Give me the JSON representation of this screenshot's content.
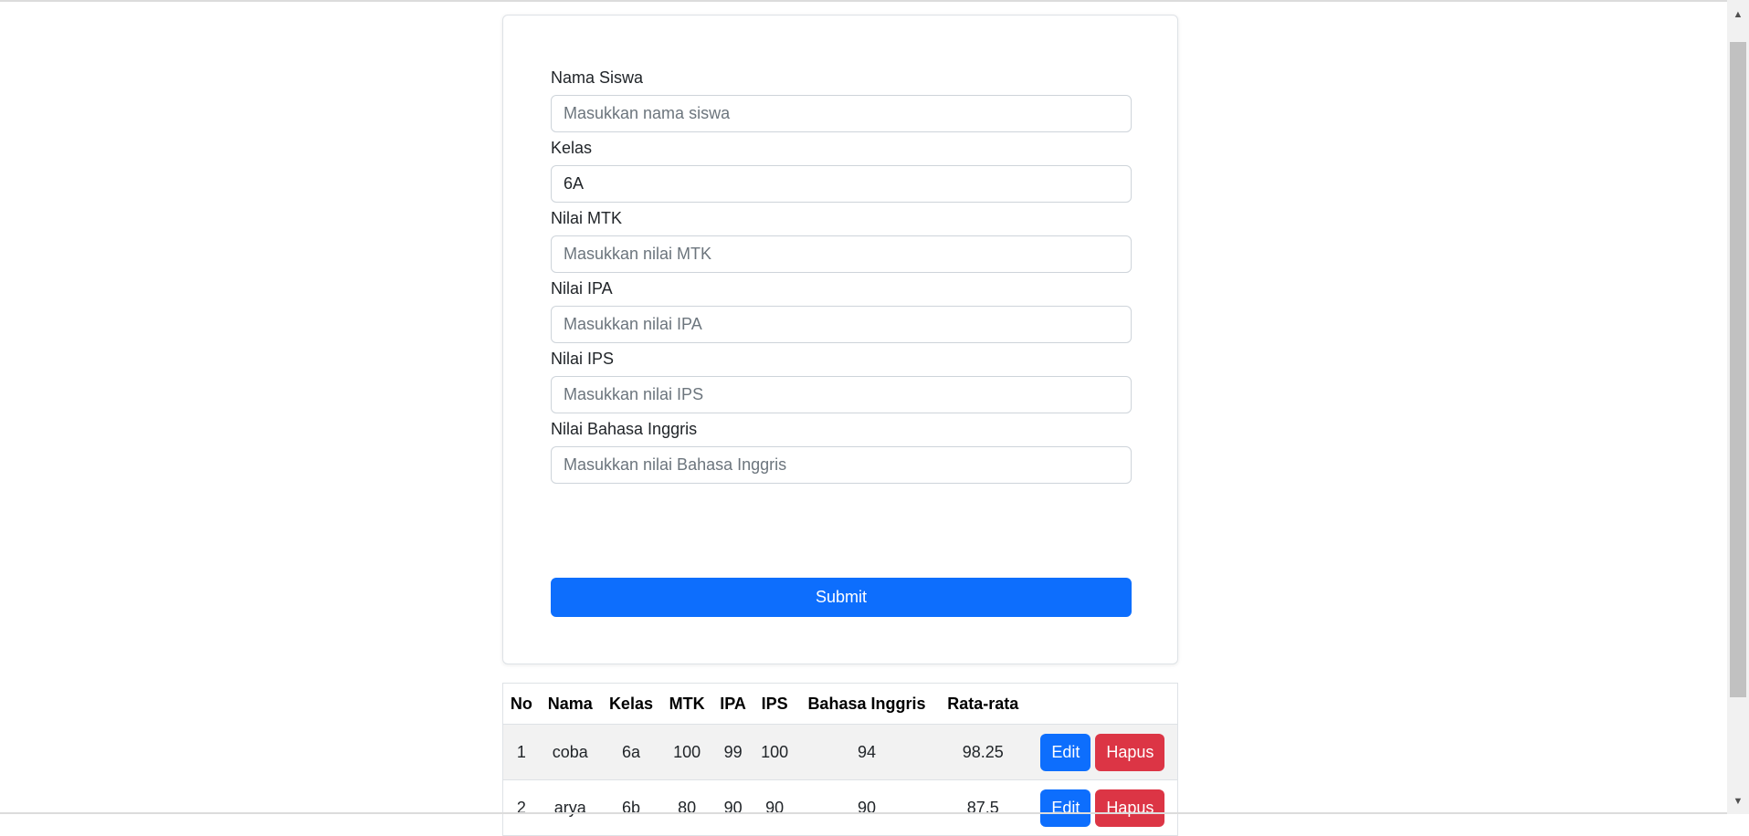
{
  "form": {
    "fields": [
      {
        "label": "Nama Siswa",
        "placeholder": "Masukkan nama siswa",
        "value": ""
      },
      {
        "label": "Kelas",
        "placeholder": "",
        "value": "6A"
      },
      {
        "label": "Nilai MTK",
        "placeholder": "Masukkan nilai MTK",
        "value": ""
      },
      {
        "label": "Nilai IPA",
        "placeholder": "Masukkan nilai IPA",
        "value": ""
      },
      {
        "label": "Nilai IPS",
        "placeholder": "Masukkan nilai IPS",
        "value": ""
      },
      {
        "label": "Nilai Bahasa Inggris",
        "placeholder": "Masukkan nilai Bahasa Inggris",
        "value": ""
      }
    ],
    "submit_label": "Submit"
  },
  "table": {
    "headers": [
      "No",
      "Nama",
      "Kelas",
      "MTK",
      "IPA",
      "IPS",
      "Bahasa Inggris",
      "Rata-rata",
      ""
    ],
    "rows": [
      {
        "no": "1",
        "nama": "coba",
        "kelas": "6a",
        "mtk": "100",
        "ipa": "99",
        "ips": "100",
        "bahasa_inggris": "94",
        "rata_rata": "98.25",
        "edit_label": "Edit",
        "hapus_label": "Hapus"
      },
      {
        "no": "2",
        "nama": "arya",
        "kelas": "6b",
        "mtk": "80",
        "ipa": "90",
        "ips": "90",
        "bahasa_inggris": "90",
        "rata_rata": "87.5",
        "edit_label": "Edit",
        "hapus_label": "Hapus"
      }
    ]
  },
  "scrollbar": {
    "up_icon": "chevron-up-icon",
    "down_icon": "chevron-down-icon"
  }
}
